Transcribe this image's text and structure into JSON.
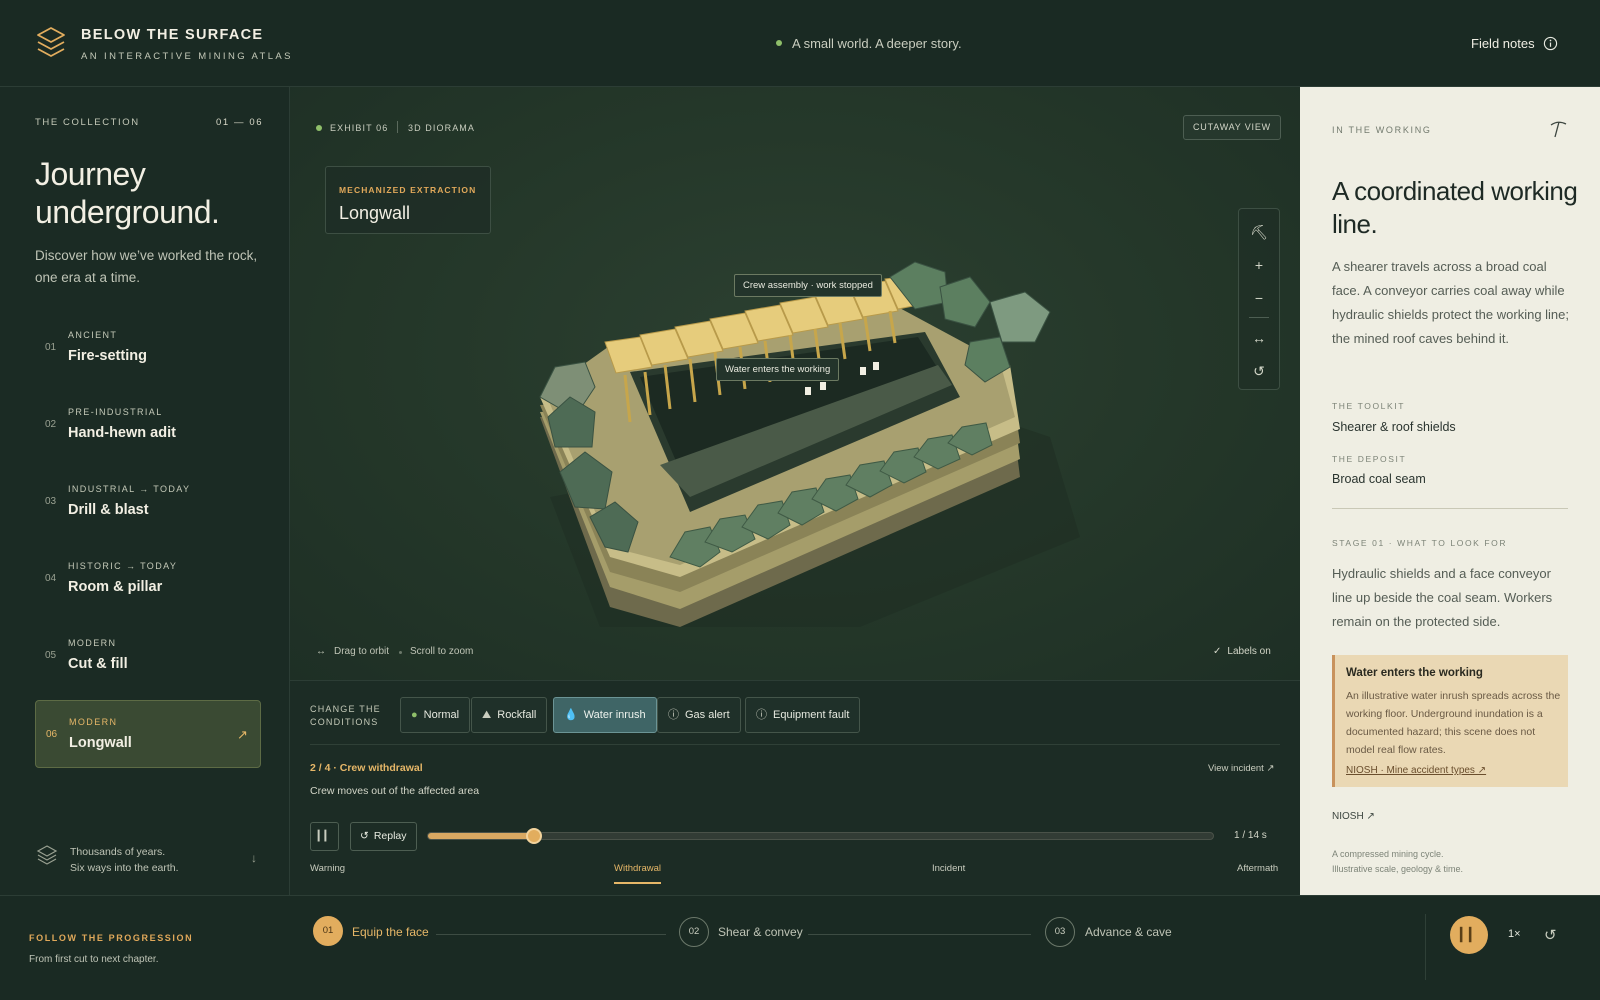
{
  "header": {
    "title": "BELOW THE SURFACE",
    "subtitle": "AN INTERACTIVE MINING ATLAS",
    "tagline": "A small world. A deeper story.",
    "field_notes": "Field notes"
  },
  "sidebar": {
    "collection_label": "THE COLLECTION",
    "range": "01 — 06",
    "heading": "Journey underground.",
    "description": "Discover how we’ve worked the rock, one era at a time.",
    "eras": [
      {
        "num": "01",
        "period": "ANCIENT",
        "name": "Fire-setting"
      },
      {
        "num": "02",
        "period": "PRE-INDUSTRIAL",
        "name": "Hand-hewn adit"
      },
      {
        "num": "03",
        "period": "INDUSTRIAL → TODAY",
        "name": "Drill & blast"
      },
      {
        "num": "04",
        "period": "HISTORIC → TODAY",
        "name": "Room & pillar"
      },
      {
        "num": "05",
        "period": "MODERN",
        "name": "Cut & fill"
      },
      {
        "num": "06",
        "period": "MODERN",
        "name": "Longwall"
      }
    ],
    "active_arrow": "↗",
    "footer_line1": "Thousands of years.",
    "footer_line2": "Six ways into the earth."
  },
  "viewer": {
    "exhibit": "EXHIBIT 06",
    "exhibit_type": "3D DIORAMA",
    "cutaway": "CUTAWAY VIEW",
    "kicker": "MECHANIZED EXTRACTION",
    "title": "Longwall",
    "callout_crew": "Crew assembly · work stopped",
    "callout_water": "Water enters the working",
    "hint_orbit": "Drag to orbit",
    "hint_zoom": "Scroll to zoom",
    "labels_on": "Labels on"
  },
  "conditions": {
    "label_line1": "CHANGE THE",
    "label_line2": "CONDITIONS",
    "options": [
      {
        "label": "Normal",
        "icon": "status-dot"
      },
      {
        "label": "Rockfall",
        "icon": "mountain-icon"
      },
      {
        "label": "Water inrush",
        "icon": "droplet-icon"
      },
      {
        "label": "Gas alert",
        "icon": "info-icon"
      },
      {
        "label": "Equipment fault",
        "icon": "info-icon"
      }
    ],
    "active": "Water inrush",
    "step_title": "2 / 4 · Crew withdrawal",
    "step_desc": "Crew moves out of the affected area",
    "view_incident": "View incident ↗",
    "replay": "Replay",
    "progress": 0.135,
    "time": "1 / 14 s",
    "phases": [
      "Warning",
      "Withdrawal",
      "Incident",
      "Aftermath"
    ],
    "active_phase": "Withdrawal"
  },
  "right_panel": {
    "kicker": "IN THE WORKING",
    "title": "A coordinated working line.",
    "body": "A shearer travels across a broad coal face. A conveyor carries coal away while hydraulic shields protect the working line; the mined roof caves behind it.",
    "toolkit_label": "THE TOOLKIT",
    "toolkit_value": "Shearer & roof shields",
    "deposit_label": "THE DEPOSIT",
    "deposit_value": "Broad coal seam",
    "stage_label": "STAGE 01 · WHAT TO LOOK FOR",
    "stage_body": "Hydraulic shields and a face conveyor line up beside the coal seam. Workers remain on the protected side.",
    "alert_title": "Water enters the working",
    "alert_body": "An illustrative water inrush spreads across the working floor. Underground inundation is a documented hazard; this scene does not model real flow rates.",
    "alert_link": "NIOSH · Mine accident types ↗",
    "niosh": "NIOSH ↗",
    "footnote_line1": "A compressed mining cycle.",
    "footnote_line2": "Illustrative scale, geology & time."
  },
  "footer": {
    "follow": "FOLLOW THE PROGRESSION",
    "follow_sub": "From first cut to next chapter.",
    "steps": [
      {
        "num": "01",
        "label": "Equip the face"
      },
      {
        "num": "02",
        "label": "Shear & convey"
      },
      {
        "num": "03",
        "label": "Advance & cave"
      }
    ],
    "speed": "1×"
  },
  "colors": {
    "accent": "#e2ad5e",
    "background": "#1a2a23",
    "panel_light": "#efeee3",
    "active_condition": "#3f6566"
  }
}
